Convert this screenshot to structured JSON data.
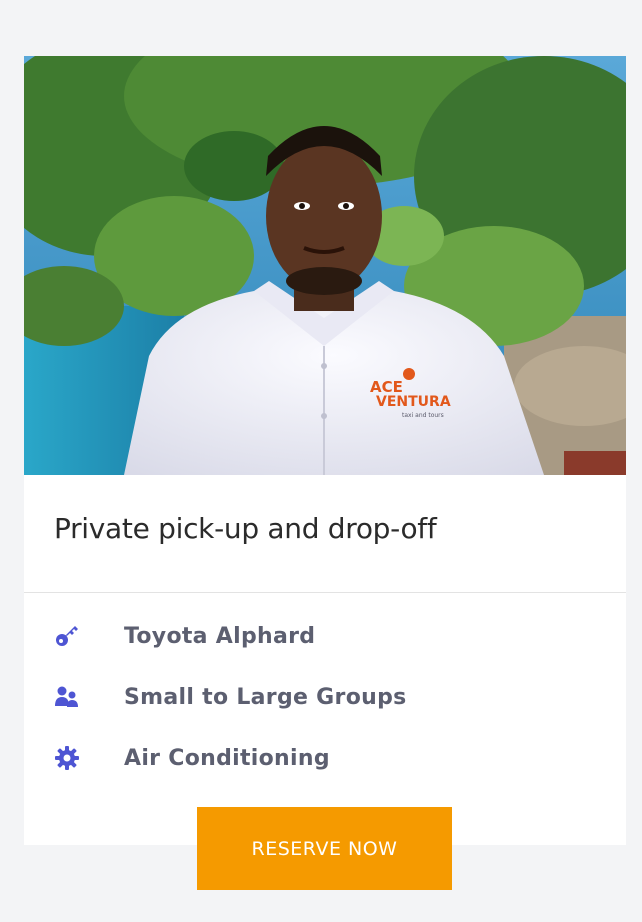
{
  "card": {
    "title": "Private pick-up and drop-off",
    "photo_logo_text_line1": "ACE",
    "photo_logo_text_line2": "VENTURA",
    "photo_logo_text_line3": "taxi and tours",
    "features": [
      {
        "icon": "key-icon",
        "label": "Toyota Alphard"
      },
      {
        "icon": "users-icon",
        "label": "Small to Large Groups"
      },
      {
        "icon": "gear-icon",
        "label": "Air Conditioning"
      }
    ],
    "cta_label": "RESERVE NOW"
  },
  "colors": {
    "page_bg": "#f3f4f6",
    "card_bg": "#ffffff",
    "icon": "#4e55d3",
    "feature_text": "#5c5f70",
    "cta_bg": "#f59a00",
    "cta_text": "#ffffff"
  }
}
